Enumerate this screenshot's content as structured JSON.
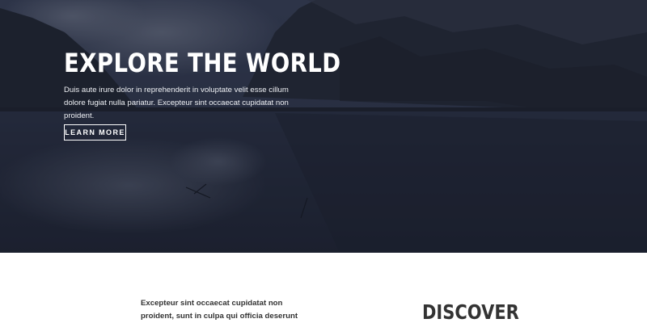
{
  "hero": {
    "title": "EXPLORE THE WORLD",
    "text": "Duis aute irure dolor in reprehenderit in voluptate velit esse cillum dolore fugiat nulla pariatur. Excepteur sint occaecat cupidatat non proident.",
    "button_label": "LEARN MORE",
    "background_image": "mountain-lake-landscape"
  },
  "section": {
    "text": "Excepteur sint occaecat cupidatat non proident, sunt in culpa qui officia deserunt",
    "heading": "DISCOVER"
  },
  "colors": {
    "overlay": "#1f2535",
    "text_light": "#ffffff",
    "text_dark": "#333333"
  }
}
